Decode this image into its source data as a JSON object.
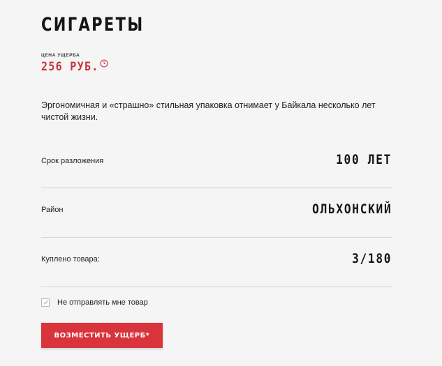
{
  "product": {
    "title": "СИГАРЕТЫ",
    "price_label": "ЦЕНА УЩЕРБА",
    "price_value": "256 РУБ.",
    "description": "Эргономичная и «страшно» стильная упаковка отнимает у Байкала несколько лет чистой жизни."
  },
  "details": [
    {
      "label": "Срок разложения",
      "value": "100 ЛЕТ"
    },
    {
      "label": "Район",
      "value": "ОЛЬХОНСКИЙ"
    },
    {
      "label": "Куплено товара:",
      "value": "3/180"
    }
  ],
  "checkbox": {
    "label": "Не отправлять мне товар",
    "checked": true
  },
  "action": {
    "button_label": "ВОЗМЕСТИТЬ УЩЕРБ*"
  },
  "colors": {
    "accent": "#d9333b",
    "price": "#c8313b",
    "background": "#f5f5f5",
    "divider": "#d3d3da"
  }
}
